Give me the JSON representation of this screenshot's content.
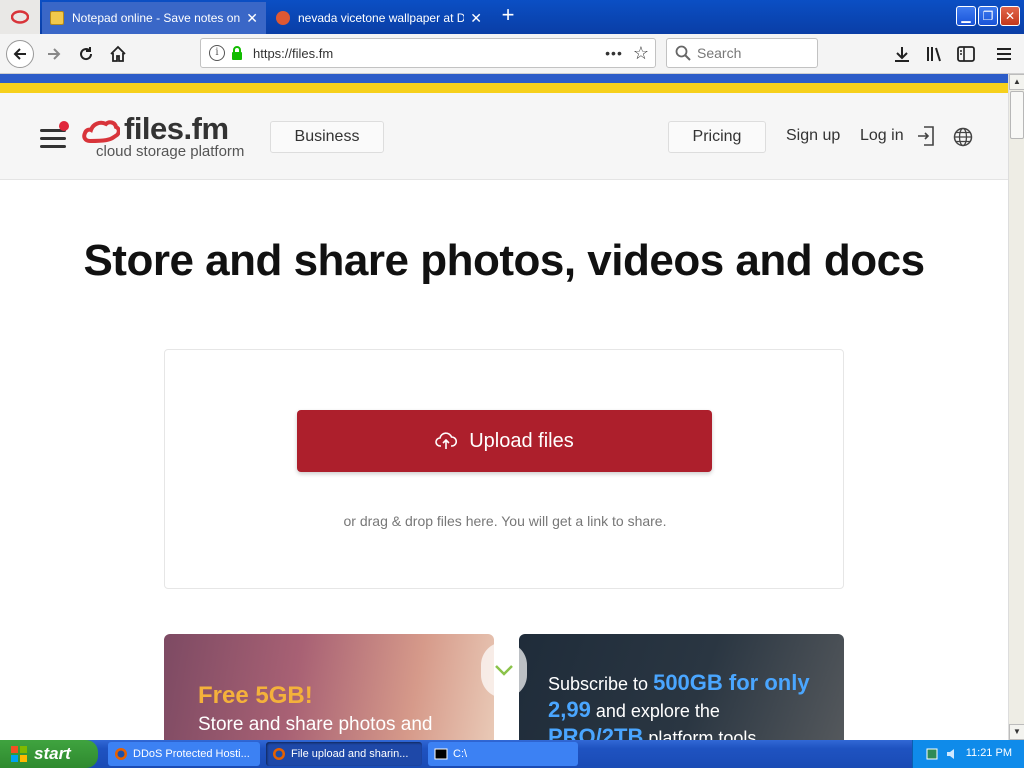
{
  "browser": {
    "tabs": [
      {
        "title": "Notepad online - Save notes online",
        "active": true
      },
      {
        "title": "nevada vicetone wallpaper at Duc",
        "active": false
      }
    ],
    "url": "https://files.fm",
    "search_placeholder": "Search"
  },
  "site": {
    "logo_name": "files.fm",
    "logo_tagline": "cloud storage platform",
    "nav": {
      "business": "Business",
      "pricing": "Pricing",
      "signup": "Sign up",
      "login": "Log in"
    },
    "headline": "Store and share photos, videos and docs",
    "upload_button": "Upload files",
    "drag_text": "or drag & drop files here. You will get a link to share.",
    "promo_left": {
      "title": "Free 5GB!",
      "text": "Store and share photos and"
    },
    "promo_right": {
      "text_1": "Subscribe to",
      "highlight_1": "500GB for only",
      "highlight_2": "2,99",
      "text_2": "and explore the",
      "highlight_3": "PRO/2TB",
      "text_3": "platform tools"
    }
  },
  "taskbar": {
    "start": "start",
    "tasks": [
      {
        "label": "DDoS Protected Hosti..."
      },
      {
        "label": "File upload and sharin..."
      },
      {
        "label": "C:\\"
      }
    ],
    "clock": "11:21 PM"
  },
  "colors": {
    "brand_red": "#ad1f2c",
    "promo_highlight": "#4aa6ff",
    "promo_gold": "#f4b13b"
  }
}
